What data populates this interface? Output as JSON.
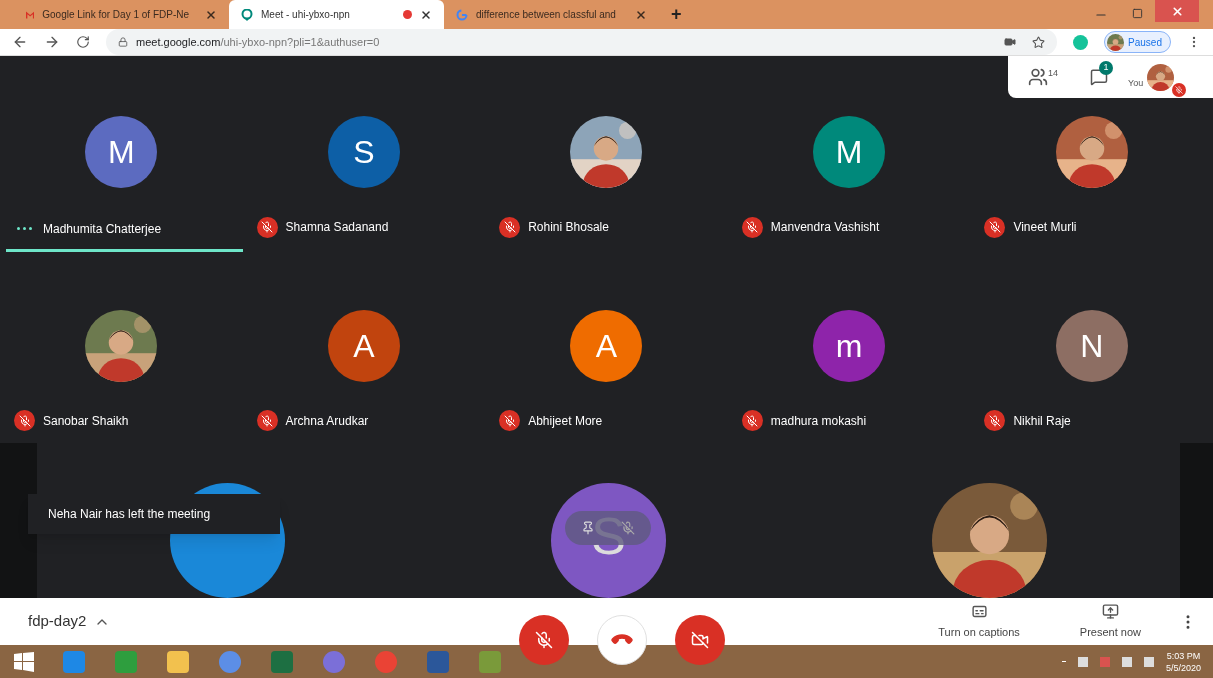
{
  "browser": {
    "tabs": [
      {
        "kind": "mail",
        "title": "Google Link for Day 1 of FDP-Ne",
        "selected": false,
        "recording": false
      },
      {
        "kind": "meet",
        "title": "Meet - uhi-ybxo-npn",
        "selected": true,
        "recording": true
      },
      {
        "kind": "google",
        "title": "difference between classful and",
        "selected": false,
        "recording": false
      }
    ],
    "new_tab": "+",
    "url_host": "meet.google.com",
    "url_path": "/uhi-ybxo-npn?pli=1&authuser=0",
    "profile": "Paused"
  },
  "top_panel": {
    "people_count": "14",
    "chat_badge": "1",
    "you_label": "You",
    "you_muted": true
  },
  "participants": [
    {
      "name": "Madhumita Chatterjee",
      "avatar": {
        "kind": "letter",
        "letter": "M",
        "color": "#5c6bc0"
      },
      "muted": false,
      "speaking": true
    },
    {
      "name": "Shamna Sadanand",
      "avatar": {
        "kind": "letter",
        "letter": "S",
        "color": "#0d5fa6"
      },
      "muted": true,
      "speaking": false
    },
    {
      "name": "Rohini Bhosale",
      "muted": true,
      "speaking": false
    },
    {
      "name": "Manvendra Vashisht",
      "avatar": {
        "kind": "letter",
        "letter": "M",
        "color": "#00897b"
      },
      "muted": true,
      "speaking": false
    },
    {
      "name": "Vineet Murli",
      "muted": true,
      "speaking": false
    },
    {
      "name": "Sanobar Shaikh",
      "muted": true,
      "speaking": false
    },
    {
      "name": "Archna Arudkar",
      "avatar": {
        "kind": "letter",
        "letter": "A",
        "color": "#c1440e"
      },
      "muted": true,
      "speaking": false
    },
    {
      "name": "Abhijeet More",
      "avatar": {
        "kind": "letter",
        "letter": "A",
        "color": "#ef6c00"
      },
      "muted": true,
      "speaking": false
    },
    {
      "name": "madhura mokashi",
      "avatar": {
        "kind": "letter",
        "letter": "m",
        "color": "#8e24aa"
      },
      "muted": true,
      "speaking": false
    },
    {
      "name": "Nikhil Raje",
      "avatar": {
        "kind": "letter",
        "letter": "N",
        "color": "#8d6e63"
      },
      "muted": true,
      "speaking": false
    }
  ],
  "partial_tiles": [
    {
      "avatar": {
        "kind": "letter",
        "color": "#1a88d8"
      },
      "controls": false
    },
    {
      "avatar": {
        "kind": "letter",
        "letter": "S",
        "color": "#7e57c2"
      },
      "controls": true
    },
    {
      "controls": false
    }
  ],
  "toast": "Neha Nair has left the meeting",
  "bottom_bar": {
    "meeting_name": "fdp-day2",
    "mic_muted": true,
    "camera_off": true,
    "actions": [
      {
        "kind": "captions",
        "label": "Turn on captions"
      },
      {
        "kind": "present",
        "label": "Present now"
      }
    ]
  },
  "taskbar": {
    "time": "5:03 PM",
    "date": "5/5/2020"
  }
}
